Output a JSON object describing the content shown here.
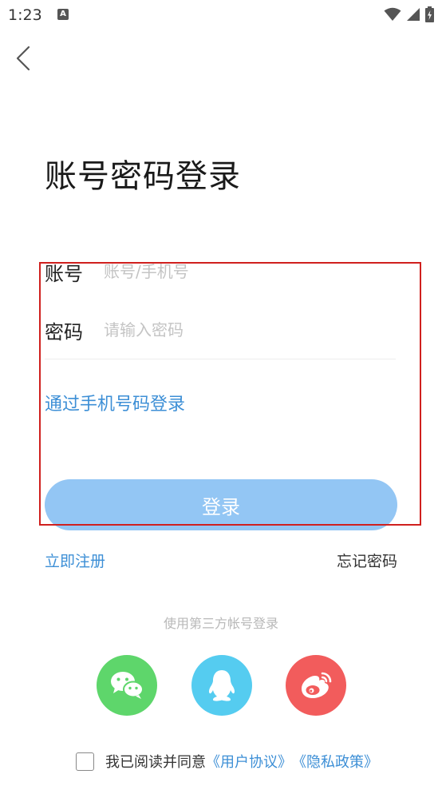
{
  "status_bar": {
    "time": "1:23",
    "app_icon_glyph": "A",
    "icons": [
      "wifi-icon",
      "cellular-signal-icon",
      "battery-charging-icon"
    ]
  },
  "header": {
    "back_icon": "chevron-left-icon"
  },
  "title": "账号密码登录",
  "form": {
    "account_label": "账号",
    "account_placeholder": "账号/手机号",
    "account_value": "",
    "password_label": "密码",
    "password_placeholder": "请输入密码",
    "password_value": ""
  },
  "phone_login_link": "通过手机号码登录",
  "login_button": "登录",
  "register_link": "立即注册",
  "forgot_password_link": "忘记密码",
  "third_party": {
    "label": "使用第三方帐号登录",
    "providers": [
      {
        "name": "wechat",
        "icon": "wechat-icon",
        "color": "#5ed66b"
      },
      {
        "name": "qq",
        "icon": "qq-penguin-icon",
        "color": "#55ccf0"
      },
      {
        "name": "weibo",
        "icon": "weibo-icon",
        "color": "#f25c5c"
      }
    ]
  },
  "agreement": {
    "text": "我已阅读并同意",
    "user_agreement": "《用户协议》",
    "privacy_policy": "《隐私政策》",
    "checked": false
  },
  "colors": {
    "accent": "#3d8fd6",
    "login_button_bg": "#93c6f4",
    "highlight_border": "#d0201e"
  }
}
